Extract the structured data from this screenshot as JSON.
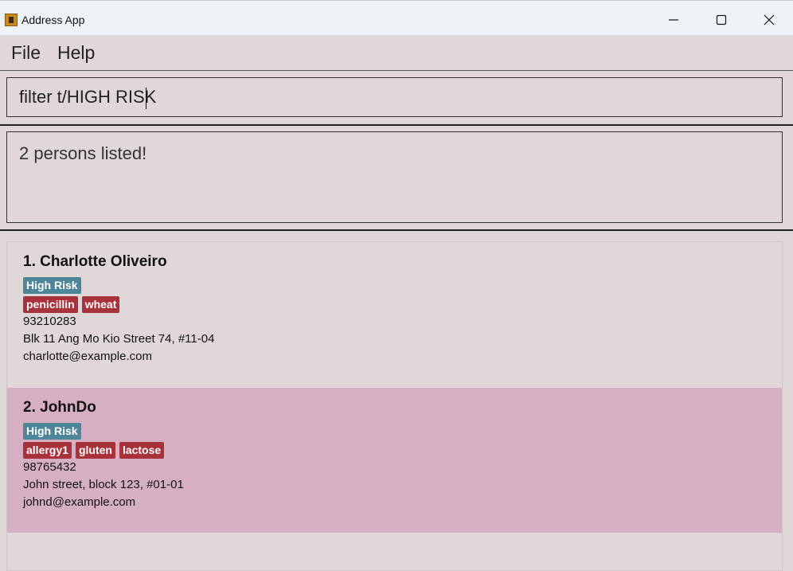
{
  "window": {
    "title": "Address App"
  },
  "menu": {
    "file": "File",
    "help": "Help"
  },
  "command": {
    "value": "filter t/HIGH RISK"
  },
  "result": {
    "message": "2 persons listed!"
  },
  "persons": [
    {
      "name": "1. Charlotte Oliveiro",
      "risk": "High Risk",
      "allergies": [
        "penicillin",
        "wheat"
      ],
      "phone": "93210283",
      "address": "Blk 11 Ang Mo Kio Street 74, #11-04",
      "email": "charlotte@example.com"
    },
    {
      "name": "2. JohnDo",
      "risk": "High Risk",
      "allergies": [
        "allergy1",
        "gluten",
        "lactose"
      ],
      "phone": "98765432",
      "address": "John street, block 123, #01-01",
      "email": "johnd@example.com"
    }
  ],
  "colors": {
    "background": "#e0d8d8",
    "selected_row": "#d7afc3",
    "risk_tag": "#4e8699",
    "allergy_tag": "#a8323b"
  },
  "icons": {
    "app": "address-app-icon",
    "minimize": "minimize-icon",
    "maximize": "maximize-icon",
    "close": "close-icon"
  }
}
